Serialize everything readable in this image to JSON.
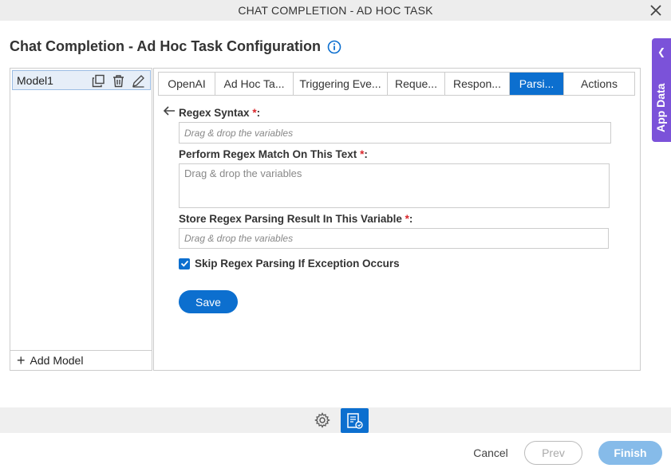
{
  "window": {
    "title": "CHAT COMPLETION - AD HOC TASK"
  },
  "page": {
    "title": "Chat Completion - Ad Hoc Task Configuration"
  },
  "app_data_tab": {
    "label": "App Data"
  },
  "models": {
    "items": [
      "Model1"
    ],
    "add_label": "Add Model"
  },
  "tabs": [
    "OpenAI",
    "Ad Hoc Ta...",
    "Triggering Eve...",
    "Reque...",
    "Respon...",
    "Parsi...",
    "Actions"
  ],
  "active_tab": "Parsi...",
  "form": {
    "regex_syntax_label": "Regex Syntax",
    "regex_syntax_placeholder": "Drag & drop the variables",
    "match_text_label": "Perform Regex Match On This Text",
    "match_text_placeholder": "Drag & drop the variables",
    "store_result_label": "Store Regex Parsing Result In This Variable",
    "store_result_placeholder": "Drag & drop the variables",
    "required_marker": "*",
    "label_suffix": ":",
    "skip_exception_label": "Skip Regex Parsing If Exception Occurs",
    "skip_exception_checked": true,
    "save_label": "Save"
  },
  "footer": {
    "cancel_label": "Cancel",
    "prev_label": "Prev",
    "finish_label": "Finish"
  },
  "colors": {
    "primary": "#0c6fcf",
    "app_data": "#7b52d9",
    "required": "#d9262b",
    "finish_disabled": "#86bbe9"
  },
  "icons": [
    "close-icon",
    "info-icon",
    "chevron-left-icon",
    "copy-icon",
    "delete-icon",
    "edit-icon",
    "plus-icon",
    "back-arrow-icon",
    "check-icon",
    "gear-icon",
    "task-icon"
  ]
}
